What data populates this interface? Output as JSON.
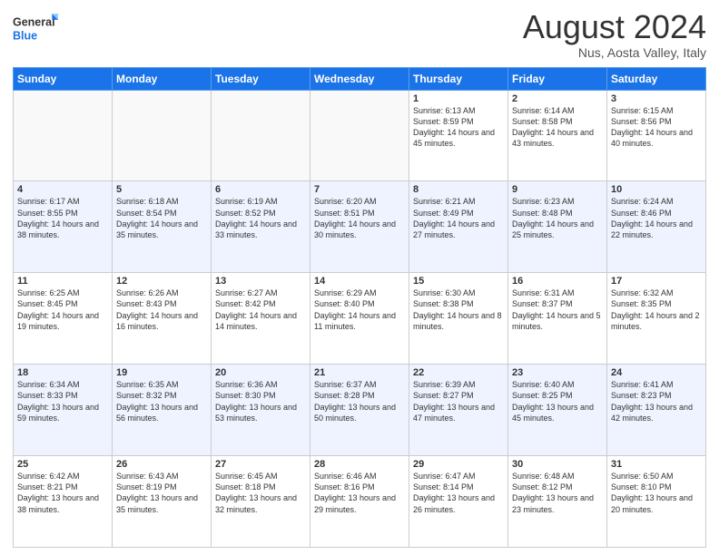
{
  "header": {
    "logo_general": "General",
    "logo_blue": "Blue",
    "month_title": "August 2024",
    "location": "Nus, Aosta Valley, Italy"
  },
  "weekdays": [
    "Sunday",
    "Monday",
    "Tuesday",
    "Wednesday",
    "Thursday",
    "Friday",
    "Saturday"
  ],
  "weeks": [
    [
      {
        "day": "",
        "info": ""
      },
      {
        "day": "",
        "info": ""
      },
      {
        "day": "",
        "info": ""
      },
      {
        "day": "",
        "info": ""
      },
      {
        "day": "1",
        "info": "Sunrise: 6:13 AM\nSunset: 8:59 PM\nDaylight: 14 hours and 45 minutes."
      },
      {
        "day": "2",
        "info": "Sunrise: 6:14 AM\nSunset: 8:58 PM\nDaylight: 14 hours and 43 minutes."
      },
      {
        "day": "3",
        "info": "Sunrise: 6:15 AM\nSunset: 8:56 PM\nDaylight: 14 hours and 40 minutes."
      }
    ],
    [
      {
        "day": "4",
        "info": "Sunrise: 6:17 AM\nSunset: 8:55 PM\nDaylight: 14 hours and 38 minutes."
      },
      {
        "day": "5",
        "info": "Sunrise: 6:18 AM\nSunset: 8:54 PM\nDaylight: 14 hours and 35 minutes."
      },
      {
        "day": "6",
        "info": "Sunrise: 6:19 AM\nSunset: 8:52 PM\nDaylight: 14 hours and 33 minutes."
      },
      {
        "day": "7",
        "info": "Sunrise: 6:20 AM\nSunset: 8:51 PM\nDaylight: 14 hours and 30 minutes."
      },
      {
        "day": "8",
        "info": "Sunrise: 6:21 AM\nSunset: 8:49 PM\nDaylight: 14 hours and 27 minutes."
      },
      {
        "day": "9",
        "info": "Sunrise: 6:23 AM\nSunset: 8:48 PM\nDaylight: 14 hours and 25 minutes."
      },
      {
        "day": "10",
        "info": "Sunrise: 6:24 AM\nSunset: 8:46 PM\nDaylight: 14 hours and 22 minutes."
      }
    ],
    [
      {
        "day": "11",
        "info": "Sunrise: 6:25 AM\nSunset: 8:45 PM\nDaylight: 14 hours and 19 minutes."
      },
      {
        "day": "12",
        "info": "Sunrise: 6:26 AM\nSunset: 8:43 PM\nDaylight: 14 hours and 16 minutes."
      },
      {
        "day": "13",
        "info": "Sunrise: 6:27 AM\nSunset: 8:42 PM\nDaylight: 14 hours and 14 minutes."
      },
      {
        "day": "14",
        "info": "Sunrise: 6:29 AM\nSunset: 8:40 PM\nDaylight: 14 hours and 11 minutes."
      },
      {
        "day": "15",
        "info": "Sunrise: 6:30 AM\nSunset: 8:38 PM\nDaylight: 14 hours and 8 minutes."
      },
      {
        "day": "16",
        "info": "Sunrise: 6:31 AM\nSunset: 8:37 PM\nDaylight: 14 hours and 5 minutes."
      },
      {
        "day": "17",
        "info": "Sunrise: 6:32 AM\nSunset: 8:35 PM\nDaylight: 14 hours and 2 minutes."
      }
    ],
    [
      {
        "day": "18",
        "info": "Sunrise: 6:34 AM\nSunset: 8:33 PM\nDaylight: 13 hours and 59 minutes."
      },
      {
        "day": "19",
        "info": "Sunrise: 6:35 AM\nSunset: 8:32 PM\nDaylight: 13 hours and 56 minutes."
      },
      {
        "day": "20",
        "info": "Sunrise: 6:36 AM\nSunset: 8:30 PM\nDaylight: 13 hours and 53 minutes."
      },
      {
        "day": "21",
        "info": "Sunrise: 6:37 AM\nSunset: 8:28 PM\nDaylight: 13 hours and 50 minutes."
      },
      {
        "day": "22",
        "info": "Sunrise: 6:39 AM\nSunset: 8:27 PM\nDaylight: 13 hours and 47 minutes."
      },
      {
        "day": "23",
        "info": "Sunrise: 6:40 AM\nSunset: 8:25 PM\nDaylight: 13 hours and 45 minutes."
      },
      {
        "day": "24",
        "info": "Sunrise: 6:41 AM\nSunset: 8:23 PM\nDaylight: 13 hours and 42 minutes."
      }
    ],
    [
      {
        "day": "25",
        "info": "Sunrise: 6:42 AM\nSunset: 8:21 PM\nDaylight: 13 hours and 38 minutes."
      },
      {
        "day": "26",
        "info": "Sunrise: 6:43 AM\nSunset: 8:19 PM\nDaylight: 13 hours and 35 minutes."
      },
      {
        "day": "27",
        "info": "Sunrise: 6:45 AM\nSunset: 8:18 PM\nDaylight: 13 hours and 32 minutes."
      },
      {
        "day": "28",
        "info": "Sunrise: 6:46 AM\nSunset: 8:16 PM\nDaylight: 13 hours and 29 minutes."
      },
      {
        "day": "29",
        "info": "Sunrise: 6:47 AM\nSunset: 8:14 PM\nDaylight: 13 hours and 26 minutes."
      },
      {
        "day": "30",
        "info": "Sunrise: 6:48 AM\nSunset: 8:12 PM\nDaylight: 13 hours and 23 minutes."
      },
      {
        "day": "31",
        "info": "Sunrise: 6:50 AM\nSunset: 8:10 PM\nDaylight: 13 hours and 20 minutes."
      }
    ]
  ]
}
